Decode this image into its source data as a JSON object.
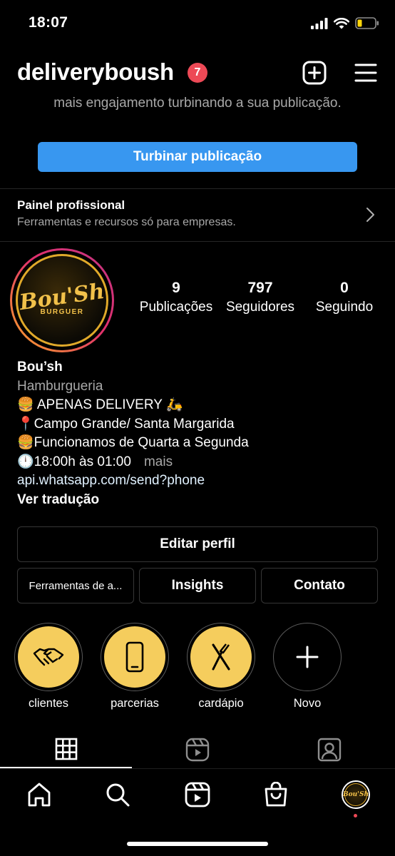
{
  "status_bar": {
    "time": "18:07",
    "icons": [
      "signal-icon",
      "wifi-icon",
      "battery-low-icon"
    ],
    "battery_color": "#ffd60a"
  },
  "header": {
    "username": "deliveryboush",
    "notification_count": "7",
    "add_icon": "plus-square-icon",
    "menu_icon": "hamburger-menu-icon"
  },
  "promo": {
    "text": "mais engajamento turbinando a sua publicação.",
    "button_label": "Turbinar publicação"
  },
  "pro_panel": {
    "title": "Painel profissional",
    "subtitle": "Ferramentas e recursos só para empresas."
  },
  "profile": {
    "avatar_text": "Bou'Sh",
    "avatar_subtext": "BURGUER",
    "stats": [
      {
        "value": "9",
        "label": "Publicações"
      },
      {
        "value": "797",
        "label": "Seguidores"
      },
      {
        "value": "0",
        "label": "Seguindo"
      }
    ]
  },
  "bio": {
    "name": "Bou’sh",
    "category": "Hamburgueria",
    "lines": [
      "🍔 APENAS DELIVERY 🛵",
      "📍Campo Grande/ Santa Margarida",
      "🍔Funcionamos de Quarta a Segunda",
      "🕛18:00h às 01:00"
    ],
    "more": "mais",
    "link": "api.whatsapp.com/send?phone",
    "translate": "Ver tradução"
  },
  "actions": {
    "edit_profile": "Editar perfil",
    "tools": "Ferramentas de a...",
    "insights": "Insights",
    "contact": "Contato"
  },
  "highlights": [
    {
      "label": "clientes",
      "icon": "handshake-icon"
    },
    {
      "label": "parcerias",
      "icon": "phone-icon"
    },
    {
      "label": "cardápio",
      "icon": "fork-knife-icon"
    },
    {
      "label": "Novo",
      "icon": "plus-icon"
    }
  ],
  "colors": {
    "accent": "#3897f0",
    "highlight_fill": "#f5cd5d",
    "badge": "#ed4956"
  }
}
